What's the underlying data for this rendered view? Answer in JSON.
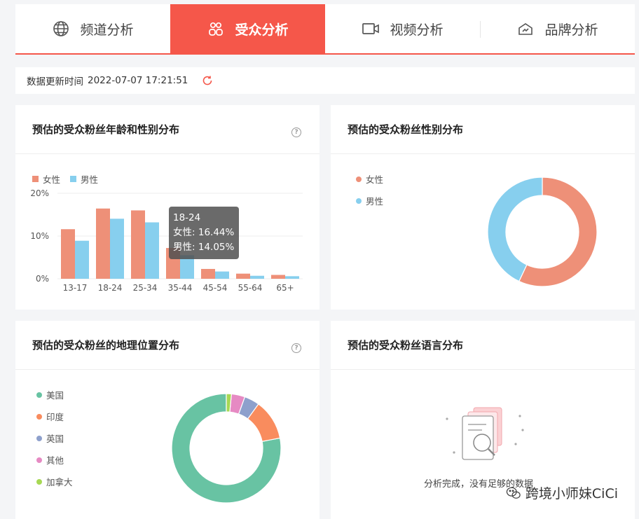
{
  "tabs": [
    {
      "label": "频道分析",
      "icon": "globe-icon",
      "active": false
    },
    {
      "label": "受众分析",
      "icon": "users-icon",
      "active": true
    },
    {
      "label": "视频分析",
      "icon": "video-camera-icon",
      "active": false
    },
    {
      "label": "品牌分析",
      "icon": "brand-icon",
      "active": false
    }
  ],
  "update": {
    "label": "数据更新时间",
    "time": "2022-07-07 17:21:51"
  },
  "age_card": {
    "title": "预估的受众粉丝年龄和性别分布",
    "legend": {
      "female": "女性",
      "male": "男性"
    },
    "tooltip": {
      "title": "18-24",
      "female_label": "女性:",
      "female_value": "16.44%",
      "male_label": "男性:",
      "male_value": "14.05%"
    }
  },
  "gender_card": {
    "title": "预估的受众粉丝性别分布",
    "legend": {
      "female": "女性",
      "male": "男性"
    }
  },
  "geo_card": {
    "title": "预估的受众粉丝的地理位置分布",
    "legend": [
      "美国",
      "印度",
      "英国",
      "其他",
      "加拿大"
    ]
  },
  "lang_card": {
    "title": "预估的受众粉丝语言分布",
    "empty_text": "分析完成，没有足够的数据"
  },
  "watermark": "跨境小师妹CiCi",
  "colors": {
    "accent": "#f5574a",
    "female": "#ee9078",
    "male": "#87cfee",
    "us": "#68c3a3",
    "india": "#f98c5e",
    "uk": "#8ea0cc",
    "other": "#e68ac3",
    "canada": "#a7d854"
  },
  "chart_data": [
    {
      "type": "bar",
      "categories": [
        "13-17",
        "18-24",
        "25-34",
        "35-44",
        "45-54",
        "55-64",
        "65+"
      ],
      "series": [
        {
          "name": "女性",
          "values": [
            11.6,
            16.44,
            16.0,
            7.2,
            2.3,
            1.2,
            0.9
          ]
        },
        {
          "name": "男性",
          "values": [
            8.9,
            14.05,
            13.2,
            5.5,
            1.7,
            0.7,
            0.6
          ]
        }
      ],
      "yticks": [
        "0%",
        "10%",
        "20%"
      ],
      "ylim": [
        0,
        20
      ],
      "legend": "top-left",
      "grid": true
    },
    {
      "type": "pie",
      "labels": [
        "女性",
        "男性"
      ],
      "values": [
        57,
        43
      ],
      "legend": "left"
    },
    {
      "type": "pie",
      "labels": [
        "美国",
        "印度",
        "英国",
        "其他",
        "加拿大"
      ],
      "values": [
        78,
        12,
        4.5,
        4,
        1.5
      ],
      "legend": "left"
    }
  ]
}
